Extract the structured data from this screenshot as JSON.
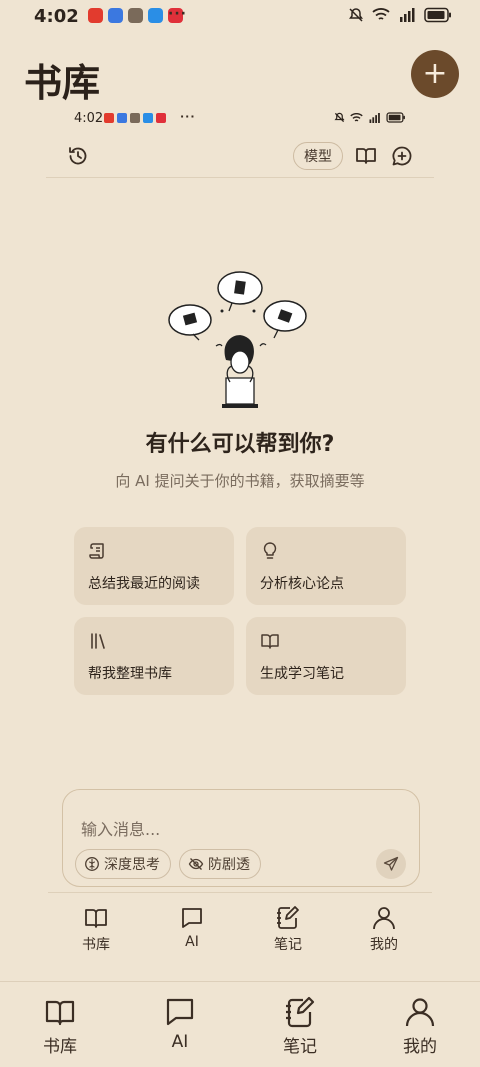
{
  "status_bar": {
    "time": "4:02",
    "more": "···"
  },
  "mini_status_bar": {
    "time": "4:02",
    "more": "···"
  },
  "header": {
    "title": "书库",
    "add_label": "+"
  },
  "toolbar": {
    "model_label": "模型"
  },
  "hero": {
    "headline": "有什么可以帮到你?",
    "subline": "向 AI 提问关于你的书籍，获取摘要等"
  },
  "suggestions": [
    {
      "label": "总结我最近的阅读",
      "icon": "scroll-icon"
    },
    {
      "label": "分析核心论点",
      "icon": "lightbulb-icon"
    },
    {
      "label": "帮我整理书库",
      "icon": "library-icon"
    },
    {
      "label": "生成学习笔记",
      "icon": "open-book-icon"
    }
  ],
  "composer": {
    "placeholder": "输入消息...",
    "deep_think_label": "深度思考",
    "anti_spoiler_label": "防剧透"
  },
  "inner_nav": [
    {
      "label": "书库",
      "icon": "book-icon"
    },
    {
      "label": "AI",
      "icon": "chat-icon"
    },
    {
      "label": "笔记",
      "icon": "notebook-pen-icon"
    },
    {
      "label": "我的",
      "icon": "person-icon"
    }
  ],
  "outer_nav": [
    {
      "label": "书库",
      "icon": "book-icon"
    },
    {
      "label": "AI",
      "icon": "chat-icon"
    },
    {
      "label": "笔记",
      "icon": "notebook-pen-icon"
    },
    {
      "label": "我的",
      "icon": "person-icon"
    }
  ],
  "colors": {
    "background": "#efe4d2",
    "accent": "#6b4a2b",
    "card": "#e5d7c2"
  }
}
